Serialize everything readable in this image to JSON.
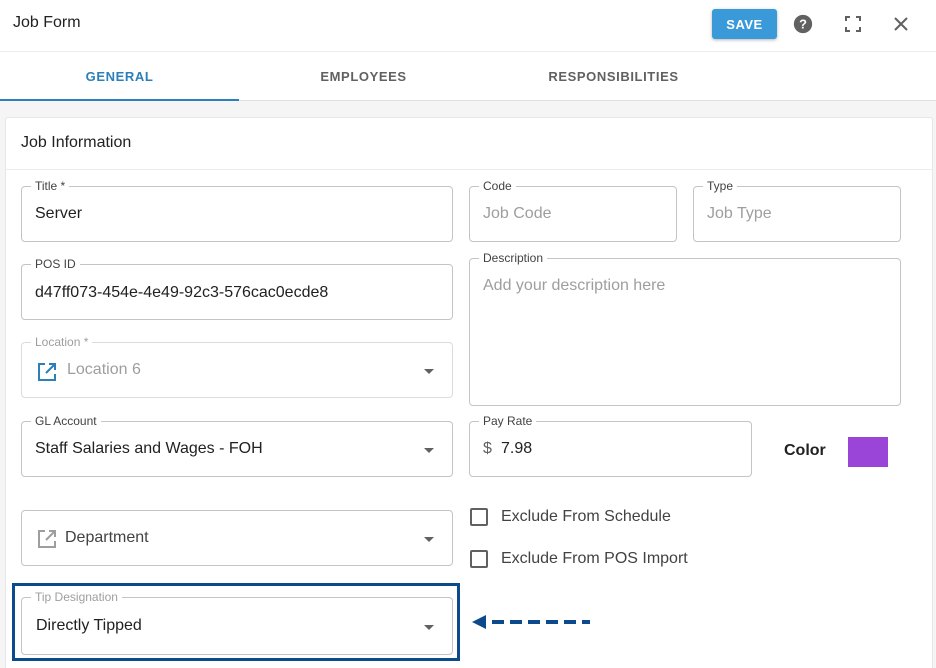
{
  "header": {
    "title": "Job Form",
    "save_label": "SAVE",
    "icons": [
      "help-icon",
      "fullscreen-icon",
      "close-icon"
    ]
  },
  "tabs": [
    {
      "label": "GENERAL",
      "active": true
    },
    {
      "label": "EMPLOYEES",
      "active": false
    },
    {
      "label": "RESPONSIBILITIES",
      "active": false
    }
  ],
  "card": {
    "title": "Job Information"
  },
  "fields": {
    "title": {
      "label": "Title *",
      "value": "Server"
    },
    "code": {
      "label": "Code",
      "placeholder": "Job Code"
    },
    "type": {
      "label": "Type",
      "placeholder": "Job Type"
    },
    "pos_id": {
      "label": "POS ID",
      "value": "d47ff073-454e-4e49-92c3-576cac0ecde8"
    },
    "description": {
      "label": "Description",
      "placeholder": "Add your description here"
    },
    "location": {
      "label": "Location *",
      "value": "Location 6",
      "disabled": true,
      "icon": "open-in-new-icon"
    },
    "gl_account": {
      "label": "GL Account",
      "value": "Staff Salaries and Wages - FOH"
    },
    "pay_rate": {
      "label": "Pay Rate",
      "prefix": "$",
      "value": "7.98"
    },
    "department": {
      "placeholder": "Department",
      "icon": "open-in-new-icon"
    },
    "tip_designation": {
      "label": "Tip Designation",
      "value": "Directly Tipped"
    }
  },
  "color": {
    "label": "Color",
    "value": "#9a44d8"
  },
  "checkboxes": [
    {
      "label": "Exclude From Schedule",
      "checked": false
    },
    {
      "label": "Exclude From POS Import",
      "checked": false
    }
  ],
  "annotation": {
    "highlight_color": "#0b4a8b",
    "arrow_color": "#0b4a8b"
  }
}
